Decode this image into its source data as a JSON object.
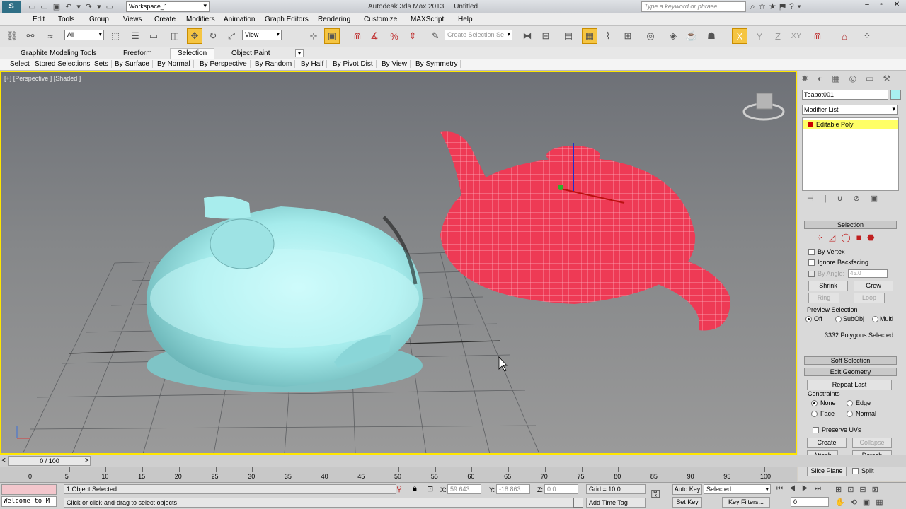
{
  "app": {
    "title": "Autodesk 3ds Max 2013",
    "doc": "Untitled",
    "workspace": "Workspace_1",
    "search_placeholder": "Type a keyword or phrase"
  },
  "menu": [
    "Edit",
    "Tools",
    "Group",
    "Views",
    "Create",
    "Modifiers",
    "Animation",
    "Graph Editors",
    "Rendering",
    "Customize",
    "MAXScript",
    "Help"
  ],
  "toolbar": {
    "filter": "All",
    "refcoord": "View",
    "selset_placeholder": "Create Selection Se"
  },
  "ribbon": {
    "tabs": [
      "Graphite Modeling Tools",
      "Freeform",
      "Selection",
      "Object Paint"
    ],
    "active": "Selection"
  },
  "subbar": [
    "Select",
    "Stored Selections",
    "Sets",
    "By Surface",
    "By Normal",
    "By Perspective",
    "By Random",
    "By Half",
    "By Pivot Dist",
    "By View",
    "By Symmetry"
  ],
  "viewport": {
    "label": "[+] [Perspective ] [Shaded ]"
  },
  "command": {
    "object_name": "Teapot001",
    "object_color": "#a8f0f0",
    "modifier_list": "Modifier List",
    "stack_item": "Editable Poly",
    "selection_title": "Selection",
    "by_vertex": "By Vertex",
    "ignore_backfacing": "Ignore Backfacing",
    "by_angle": "By Angle:",
    "angle_value": "45.0",
    "shrink": "Shrink",
    "grow": "Grow",
    "ring": "Ring",
    "loop": "Loop",
    "preview_selection": "Preview Selection",
    "off": "Off",
    "subobj": "SubObj",
    "multi": "Multi",
    "selected_count": "3332 Polygons Selected",
    "soft_selection": "Soft Selection",
    "edit_geometry": "Edit Geometry",
    "repeat_last": "Repeat Last",
    "constraints": "Constraints",
    "none": "None",
    "edge": "Edge",
    "face": "Face",
    "normal": "Normal",
    "preserve_uvs": "Preserve UVs",
    "create": "Create",
    "collapse": "Collapse",
    "attach": "Attach",
    "detach": "Detach",
    "slice_plane": "Slice Plane",
    "split": "Split"
  },
  "time": {
    "frame": "0 / 100",
    "ticks": [
      "0",
      "5",
      "10",
      "15",
      "20",
      "25",
      "30",
      "35",
      "40",
      "45",
      "50",
      "55",
      "60",
      "65",
      "70",
      "75",
      "80",
      "85",
      "90",
      "95",
      "100"
    ]
  },
  "status": {
    "welcome": "Welcome to M",
    "selected": "1 Object Selected",
    "prompt": "Click or click-and-drag to select objects",
    "x_label": "X:",
    "x": "59.643",
    "y_label": "Y:",
    "y": "-18.863",
    "z_label": "Z:",
    "z": "0.0",
    "grid": "Grid = 10.0",
    "add_time_tag": "Add Time Tag",
    "auto_key": "Auto Key",
    "set_key": "Set Key",
    "key_mode": "Selected",
    "key_filters": "Key Filters...",
    "frame_field": "0"
  },
  "colors": {
    "viewport_border": "#ffe600",
    "teapot_cyan": "#a8f0f0",
    "teapot_red": "#e8324a",
    "active_btn": "#f5c542"
  }
}
